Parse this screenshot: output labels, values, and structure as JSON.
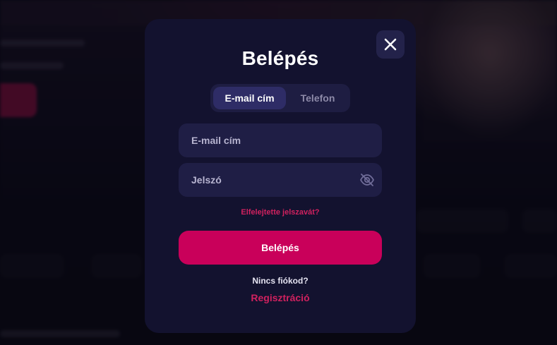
{
  "modal": {
    "title": "Belépés",
    "close_icon": "close-icon",
    "tabs": [
      {
        "label": "E-mail cím",
        "active": true
      },
      {
        "label": "Telefon",
        "active": false
      }
    ],
    "email_field": {
      "placeholder": "E-mail cím",
      "value": ""
    },
    "password_field": {
      "placeholder": "Jelszó",
      "value": "",
      "toggle_icon": "eye-off-icon"
    },
    "forgot_password": "Elfelejtette jelszavát?",
    "login_button": "Belépés",
    "no_account": "Nincs fiókod?",
    "register_link": "Regisztráció"
  },
  "colors": {
    "modal_background": "#13122f",
    "field_background": "#1f1e45",
    "accent": "#c9005a",
    "link": "#d0215f",
    "active_tab": "#2e2c66"
  }
}
